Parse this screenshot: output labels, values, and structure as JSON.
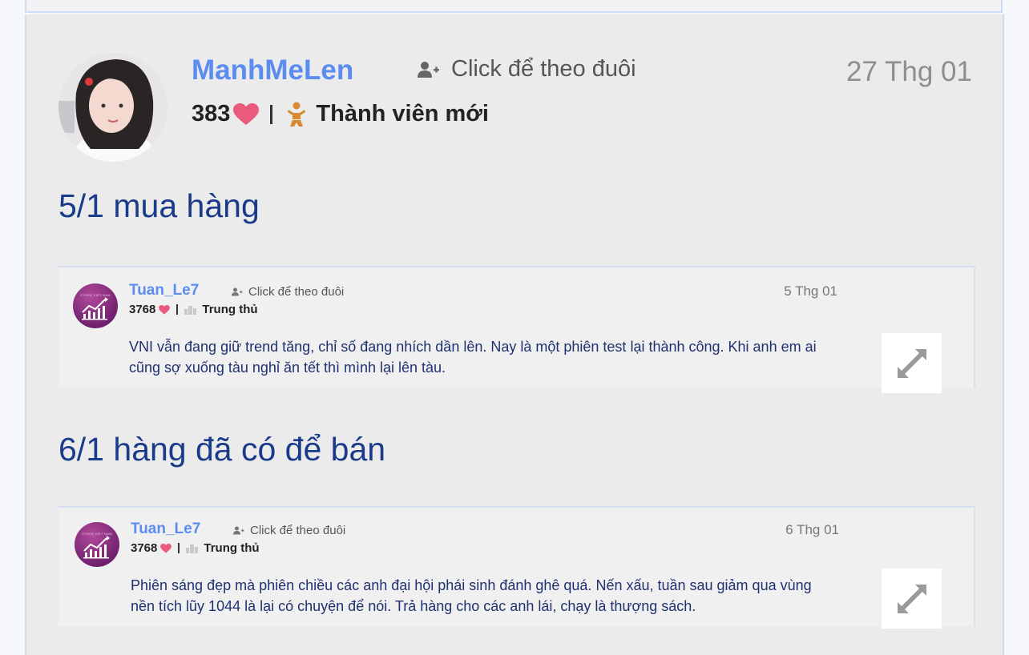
{
  "post": {
    "username": "ManhMeLen",
    "follow_label": "Click để theo đuôi",
    "date": "27 Thg 01",
    "likes": "383",
    "rank": "Thành viên mới",
    "headings": [
      "5/1 mua hàng",
      "6/1 hàng đã có để bán"
    ]
  },
  "quotes": [
    {
      "username": "Tuan_Le7",
      "follow_label": "Click để theo đuôi",
      "date": "5 Thg 01",
      "likes": "3768",
      "rank": "Trung thủ",
      "text": "VNI vẫn đang giữ trend tăng, chỉ số đang nhích dần lên. Nay là một phiên test lại thành công. Khi anh em ai cũng sợ xuống tàu nghỉ ăn tết thì mình lại lên tàu.",
      "avatar_brand": "STOCK VIET NAM"
    },
    {
      "username": "Tuan_Le7",
      "follow_label": "Click để theo đuôi",
      "date": "6 Thg 01",
      "likes": "3768",
      "rank": "Trung thủ",
      "text": "Phiên sáng đẹp mà phiên chiều các anh đại hội phái sinh đánh ghê quá. Nến xấu, tuần sau giảm qua vùng nền tích lũy 1044 là lại có chuyện để nói. Trả hàng cho các anh lái, chạy là thượng sách.",
      "avatar_brand": "STOCK VIET NAM"
    }
  ],
  "colors": {
    "accent_blue": "#5b8df0",
    "heading_blue": "#1a3a8a",
    "heart": "#ea5a7a",
    "rank_orange": "#d88a2e"
  },
  "icons": [
    "user-plus-icon",
    "heart-icon",
    "baby-rank-icon",
    "trophy-rank-icon",
    "expand-icon"
  ]
}
